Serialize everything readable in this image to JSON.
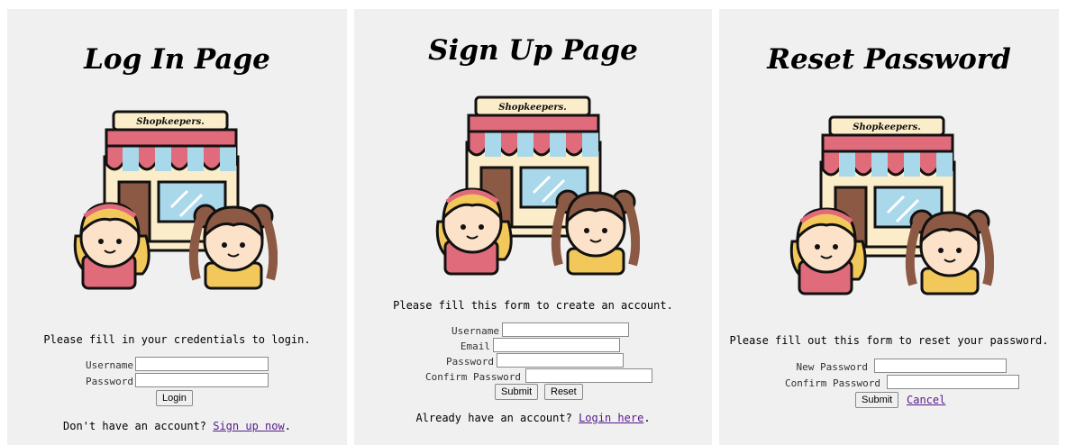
{
  "login": {
    "title": "Log In Page",
    "logo_text": "Shopkeepers.",
    "lead": "Please fill in your credentials to login.",
    "username_label": "Username",
    "password_label": "Password",
    "submit_label": "Login",
    "footer_text": "Don't have an account? ",
    "footer_link": "Sign up now",
    "footer_tail": "."
  },
  "signup": {
    "title": "Sign Up Page",
    "logo_text": "Shopkeepers.",
    "lead": "Please fill this form to create an account.",
    "username_label": "Username",
    "email_label": "Email",
    "password_label": "Password",
    "confirm_label": "Confirm Password",
    "submit_label": "Submit",
    "reset_label": "Reset",
    "footer_text": "Already have an account? ",
    "footer_link": "Login here",
    "footer_tail": "."
  },
  "reset": {
    "title": "Reset Password",
    "logo_text": "Shopkeepers.",
    "lead": "Please fill out this form to reset your password.",
    "new_password_label": "New Password",
    "confirm_label": "Confirm Password",
    "submit_label": "Submit",
    "cancel_label": "Cancel"
  },
  "colors": {
    "panel_bg": "#f0f0f0",
    "awning_red": "#e06b7a",
    "awning_blue": "#a9d8ea",
    "wall": "#fbedc9",
    "door": "#8c5a44",
    "link": "#551a8b"
  }
}
